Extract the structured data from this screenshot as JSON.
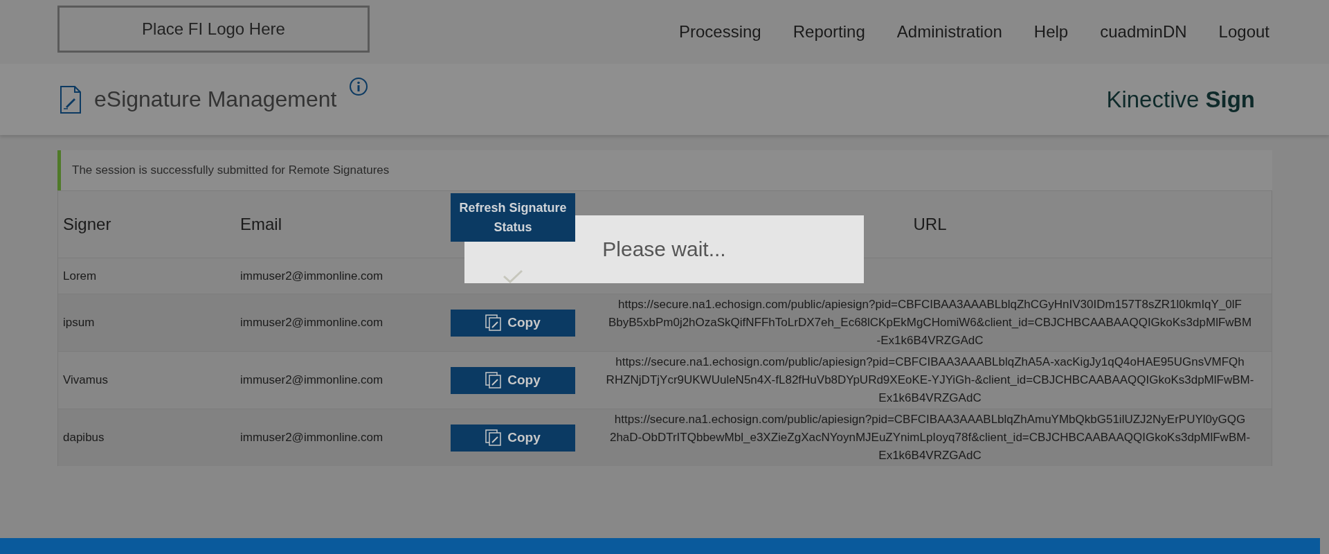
{
  "logo": {
    "text": "Place FI Logo Here"
  },
  "nav": [
    "Processing",
    "Reporting",
    "Administration",
    "Help",
    "cuadminDN",
    "Logout"
  ],
  "page": {
    "title": "eSignature Management",
    "brand": "Kinective",
    "brand_bold": "Sign"
  },
  "alert": {
    "text": "The session is successfully submitted for Remote Signatures"
  },
  "table": {
    "columns": [
      "Signer",
      "Email",
      "URL"
    ],
    "refresh_button": "Refresh Signature Status",
    "rows": [
      {
        "signer": "Lorem",
        "email": "immuser2@immonline.com",
        "signed": true
      },
      {
        "signer": "ipsum",
        "email": "immuser2@immonline.com",
        "signed": false,
        "button": "Copy",
        "url": [
          "https://secure.na1.echosign.com/public/apiesign?pid=CBFCIBAA3AAABLblqZhCGyHnIV30IDm157T8sZR1l0kmIqY_0lF",
          "BbyB5xbPm0j2hOzaSkQifNFFhToLrDX7eh_Ec68lCKpEkMgCHomiW6&client_id=CBJCHBCAABAAQQIGkoKs3dpMlFwBM",
          "-Ex1k6B4VRZGAdC"
        ]
      },
      {
        "signer": "Vivamus",
        "email": "immuser2@immonline.com",
        "signed": false,
        "button": "Copy",
        "url": [
          "https://secure.na1.echosign.com/public/apiesign?pid=CBFCIBAA3AAABLblqZhA5A-xacKigJy1qQ4oHAE95UGnsVMFQh",
          "RHZNjDTjYcr9UKWUuleN5n4X-fL82fHuVb8DYpURd9XEoKE-YJYiGh-&client_id=CBJCHBCAABAAQQIGkoKs3dpMlFwBM-",
          "Ex1k6B4VRZGAdC"
        ]
      },
      {
        "signer": "dapibus",
        "email": "immuser2@immonline.com",
        "signed": false,
        "button": "Copy",
        "url": [
          "https://secure.na1.echosign.com/public/apiesign?pid=CBFCIBAA3AAABLblqZhAmuYMbQkbG51ilUZJ2NyErPUYl0yGQG",
          "2haD-ObDTrITQbbewMbl_e3XZieZgXacNYoynMJEuZYnimLpIoyq78f&client_id=CBJCHBCAABAAQQIGkoKs3dpMlFwBM-",
          "Ex1k6B4VRZGAdC"
        ]
      }
    ]
  },
  "modal": {
    "text": "Please wait..."
  }
}
